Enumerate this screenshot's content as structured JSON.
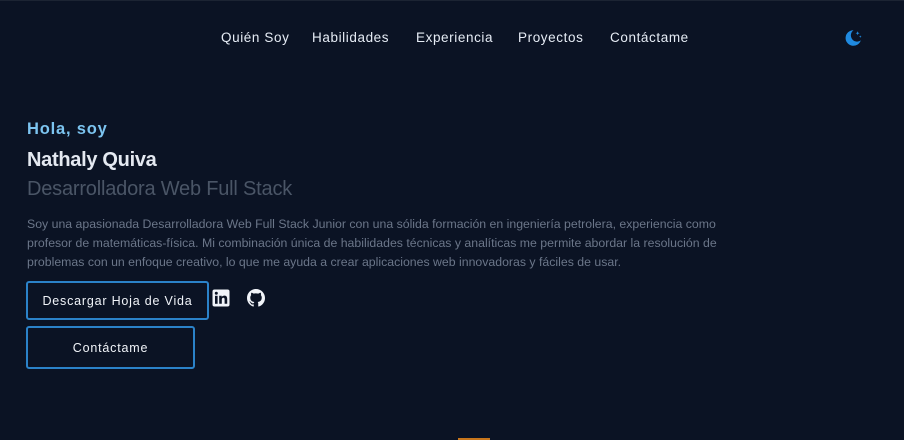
{
  "nav": {
    "items": [
      {
        "label": "Quién Soy"
      },
      {
        "label": "Habilidades"
      },
      {
        "label": "Experiencia"
      },
      {
        "label": "Proyectos"
      },
      {
        "label": "Contáctame"
      }
    ],
    "theme_toggle_icon": "moon-stars-icon"
  },
  "hero": {
    "greeting": "Hola, soy",
    "name": "Nathaly Quiva",
    "role": "Desarrolladora Web Full Stack",
    "bio": "Soy una apasionada Desarrolladora Web Full Stack Junior con una sólida formación en ingeniería petrolera, experiencia como profesor de matemáticas-física. Mi combinación única de habilidades técnicas y analíticas me permite abordar la resolución de problemas con un enfoque creativo, lo que me ayuda a crear aplicaciones web innovadoras y fáciles de usar.",
    "download_cv_label": "Descargar Hoja de Vida",
    "contact_label": "Contáctame",
    "social_icons": [
      "linkedin-icon",
      "github-icon"
    ]
  },
  "colors": {
    "background": "#0b1324",
    "accent": "#2b82c9",
    "greeting": "#7cc4f0",
    "name": "#e4e9f1",
    "role": "#4a5566",
    "bio": "#6b7689"
  }
}
